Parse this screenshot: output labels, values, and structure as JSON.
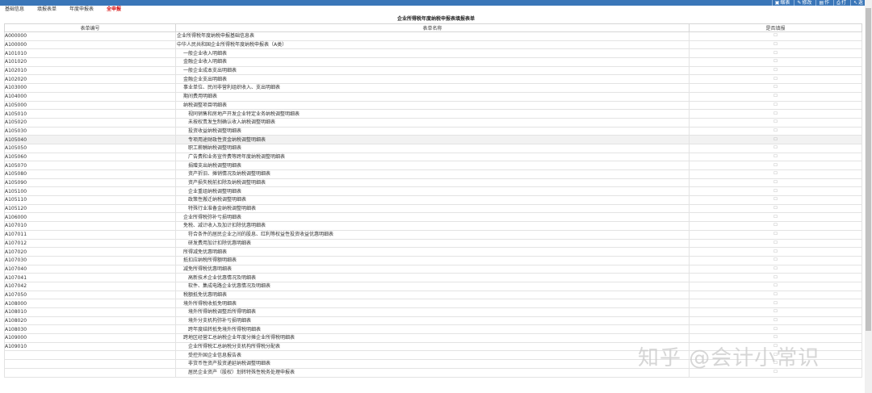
{
  "toolbar": {
    "buttons": [
      {
        "icon": "print-preview-icon",
        "glyph": "▣",
        "label": "缩表"
      },
      {
        "icon": "edit-icon",
        "glyph": "✎",
        "label": "修改"
      },
      {
        "icon": "doc-icon",
        "glyph": "▤",
        "label": "作"
      },
      {
        "icon": "print-icon",
        "glyph": "⎙",
        "label": "打"
      },
      {
        "icon": "back-icon",
        "glyph": "↖",
        "label": "返"
      }
    ]
  },
  "tabs": [
    {
      "label": "基础信息",
      "active": false
    },
    {
      "label": "填报表单",
      "active": false
    },
    {
      "label": "年度申报表",
      "active": false
    },
    {
      "label": "全申报",
      "active": true
    }
  ],
  "page_title": "企业所得税年度纳税申报表填报表单",
  "table": {
    "headers": [
      "表单编号",
      "表单名称",
      "是否填报"
    ],
    "rows": [
      {
        "code": "A000000",
        "name": "企业所得税年度纳税申报基础信息表",
        "indent": 0
      },
      {
        "code": "A100000",
        "name": "中华人民共和国企业所得税年度纳税申报表（A类）",
        "indent": 0
      },
      {
        "code": "A101010",
        "name": "一般企业收入明细表",
        "indent": 1
      },
      {
        "code": "A101020",
        "name": "金融企业收入明细表",
        "indent": 1
      },
      {
        "code": "A102010",
        "name": "一般企业成本支出明细表",
        "indent": 1
      },
      {
        "code": "A102020",
        "name": "金融企业支出明细表",
        "indent": 1
      },
      {
        "code": "A103000",
        "name": "事业单位、民间非营利组织收入、支出明细表",
        "indent": 1
      },
      {
        "code": "A104000",
        "name": "期间费用明细表",
        "indent": 1
      },
      {
        "code": "A105000",
        "name": "纳税调整项目明细表",
        "indent": 1
      },
      {
        "code": "A105010",
        "name": "视同销售和房地产开发企业特定业务纳税调整明细表",
        "indent": 2
      },
      {
        "code": "A105020",
        "name": "未按权责发生制确认收入纳税调整明细表",
        "indent": 2
      },
      {
        "code": "A105030",
        "name": "投资收益纳税调整明细表",
        "indent": 2
      },
      {
        "code": "A105040",
        "name": "专项用途财政性资金纳税调整明细表",
        "indent": 2
      },
      {
        "code": "A105050",
        "name": "职工薪酬纳税调整明细表",
        "indent": 2
      },
      {
        "code": "A105060",
        "name": "广告费和业务宣传费等跨年度纳税调整明细表",
        "indent": 2
      },
      {
        "code": "A105070",
        "name": "捐赠支出纳税调整明细表",
        "indent": 2
      },
      {
        "code": "A105080",
        "name": "资产折旧、摊销情况及纳税调整明细表",
        "indent": 2
      },
      {
        "code": "A105090",
        "name": "资产损失税前扣除及纳税调整明细表",
        "indent": 2
      },
      {
        "code": "A105100",
        "name": "企业重组纳税调整明细表",
        "indent": 2
      },
      {
        "code": "A105110",
        "name": "政策性搬迁纳税调整明细表",
        "indent": 2
      },
      {
        "code": "A105120",
        "name": "特殊行业准备金纳税调整明细表",
        "indent": 2
      },
      {
        "code": "A106000",
        "name": "企业所得税弥补亏损明细表",
        "indent": 1
      },
      {
        "code": "A107010",
        "name": "免税、减计收入及加计扣除优惠明细表",
        "indent": 1
      },
      {
        "code": "A107011",
        "name": "符合条件的居民企业之间的股息、红利等权益性投资收益优惠明细表",
        "indent": 2
      },
      {
        "code": "A107012",
        "name": "研发费用加计扣除优惠明细表",
        "indent": 2
      },
      {
        "code": "A107020",
        "name": "所得减免优惠明细表",
        "indent": 1
      },
      {
        "code": "A107030",
        "name": "抵扣应纳税所得额明细表",
        "indent": 1
      },
      {
        "code": "A107040",
        "name": "减免所得税优惠明细表",
        "indent": 1
      },
      {
        "code": "A107041",
        "name": "高新技术企业优惠情况及明细表",
        "indent": 2
      },
      {
        "code": "A107042",
        "name": "软件、集成电路企业优惠情况及明细表",
        "indent": 2
      },
      {
        "code": "A107050",
        "name": "税额抵免优惠明细表",
        "indent": 1
      },
      {
        "code": "A108000",
        "name": "境外所得税收抵免明细表",
        "indent": 1
      },
      {
        "code": "A108010",
        "name": "境外所得纳税调整后所得明细表",
        "indent": 2
      },
      {
        "code": "A108020",
        "name": "境外分支机构弥补亏损明细表",
        "indent": 2
      },
      {
        "code": "A108030",
        "name": "跨年度结转抵免境外所得税明细表",
        "indent": 2
      },
      {
        "code": "A109000",
        "name": "跨地区经营汇总纳税企业年度分摊企业所得税明细表",
        "indent": 1
      },
      {
        "code": "A109010",
        "name": "企业所得税汇总纳税分支机构所得税分配表",
        "indent": 2
      },
      {
        "code": "",
        "name": "受控外国企业信息报告表",
        "indent": 2
      },
      {
        "code": "",
        "name": "非货币性资产投资递延纳税调整明细表",
        "indent": 2
      },
      {
        "code": "",
        "name": "居民企业资产（股权）划转特殊性税务处理申报表",
        "indent": 2
      }
    ],
    "highlight_row": 12,
    "check_mark": "☐"
  },
  "watermark": "知乎 @会计小常识"
}
